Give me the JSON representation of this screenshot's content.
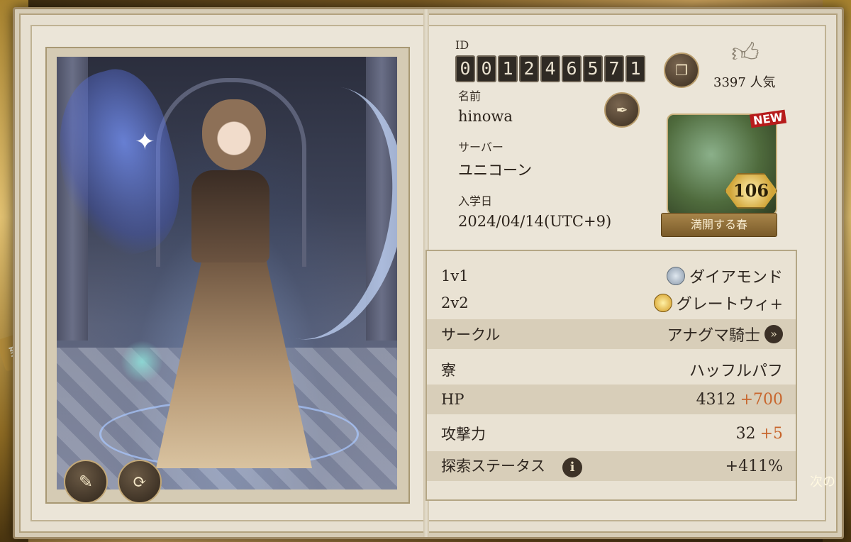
{
  "profile": {
    "id_label": "ID",
    "id_digits": [
      "0",
      "0",
      "1",
      "2",
      "4",
      "6",
      "5",
      "7",
      "1"
    ],
    "name_label": "名前",
    "name": "hinowa",
    "server_label": "サーバー",
    "server": "ユニコーン",
    "enroll_label": "入学日",
    "enroll_date": "2024/04/14(UTC+9)",
    "popularity": "3397 人気"
  },
  "badge": {
    "new_tag": "NEW",
    "level": "106",
    "caption": "満開する春"
  },
  "stats": {
    "rank_1v1": {
      "label": "1v1",
      "value": "ダイアモンド"
    },
    "rank_2v2": {
      "label": "2v2",
      "value": "グレートウィ+"
    },
    "circle": {
      "label": "サークル",
      "value": "アナグマ騎士"
    },
    "house": {
      "label": "寮",
      "value": "ハッフルパフ"
    },
    "hp": {
      "label": "HP",
      "base": "4312",
      "bonus": "+700"
    },
    "attack": {
      "label": "攻撃力",
      "base": "32",
      "bonus": "+5"
    },
    "explore": {
      "label": "探索ステータス",
      "value": "+411%"
    }
  },
  "side": {
    "left_text": "到達",
    "right_text": "次の"
  },
  "icons": {
    "edit_portrait": "edit-portrait-icon",
    "rotate": "rotate-icon",
    "copy_id": "copy-icon",
    "edit_name": "quill-icon",
    "like": "thumbs-up-icon",
    "info": "info-icon",
    "circle_go": "chevron-right-icon"
  },
  "colors": {
    "bonus": "#c8662d",
    "panel": "#e6dfd0"
  }
}
